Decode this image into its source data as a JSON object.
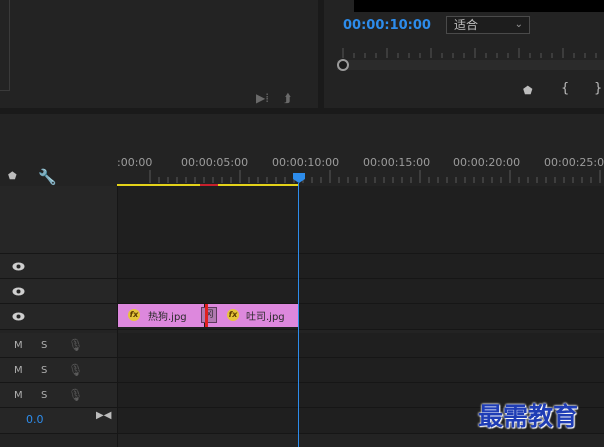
{
  "program_monitor": {
    "timecode": "00:00:10:00",
    "fit_select": "适合"
  },
  "timeline": {
    "ruler_labels": [
      ":00:00",
      "00:00:05:00",
      "00:00:10:00",
      "00:00:15:00",
      "00:00:20:00",
      "00:00:25:00"
    ],
    "playhead_timecode": "00:00:10:00",
    "audio_buttons": {
      "mute": "M",
      "solo": "S"
    },
    "volume_value": "0.0",
    "clips": [
      {
        "name": "热狗.jpg",
        "fx": "fx"
      },
      {
        "name": "吐司.jpg",
        "fx": "fx"
      }
    ],
    "transition_label": "冈"
  },
  "watermark": "最需教育"
}
